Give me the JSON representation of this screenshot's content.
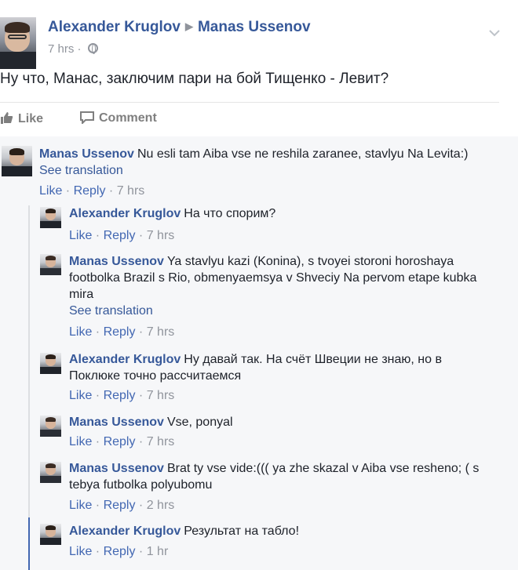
{
  "post": {
    "author": "Alexander Kruglov",
    "target": "Manas Ussenov",
    "time": "7 hrs",
    "separator": "·",
    "text": "Ну что, Манас, заключим пари на бой Тищенко - Левит?",
    "actions": {
      "like": "Like",
      "comment": "Comment"
    }
  },
  "labels": {
    "like": "Like",
    "reply": "Reply",
    "see_translation": "See translation",
    "sep": " · "
  },
  "comments": [
    {
      "name": "Manas Ussenov",
      "text": "Nu esli tam Aiba vse ne reshila zaranee, stavlyu Na Levita:)",
      "translation": true,
      "time": "7 hrs"
    },
    {
      "name": "Alexander Kruglov",
      "text": "На что спорим?",
      "translation": false,
      "time": "7 hrs"
    },
    {
      "name": "Manas Ussenov",
      "text": "Ya stavlyu kazi (Konina), s tvoyei storoni horoshaya footbolka Brazil s Rio, obmenyaemsya v Shveciy Na pervom etape kubka mira",
      "translation": true,
      "time": "7 hrs"
    },
    {
      "name": "Alexander Kruglov",
      "text": "Ну давай так. На счёт Швеции не знаю, но в Поклюке точно рассчитаемся",
      "translation": false,
      "time": "7 hrs"
    },
    {
      "name": "Manas Ussenov",
      "text": "Vse, ponyal",
      "translation": false,
      "time": "7 hrs"
    },
    {
      "name": "Manas Ussenov",
      "text": "Brat ty vse vide:((( ya zhe skazal v Aiba vse resheno; ( s tebya futbolka polyubomu",
      "translation": false,
      "time": "2 hrs"
    },
    {
      "name": "Alexander Kruglov",
      "text": "Результат на табло!",
      "translation": false,
      "time": "1 hr"
    }
  ]
}
